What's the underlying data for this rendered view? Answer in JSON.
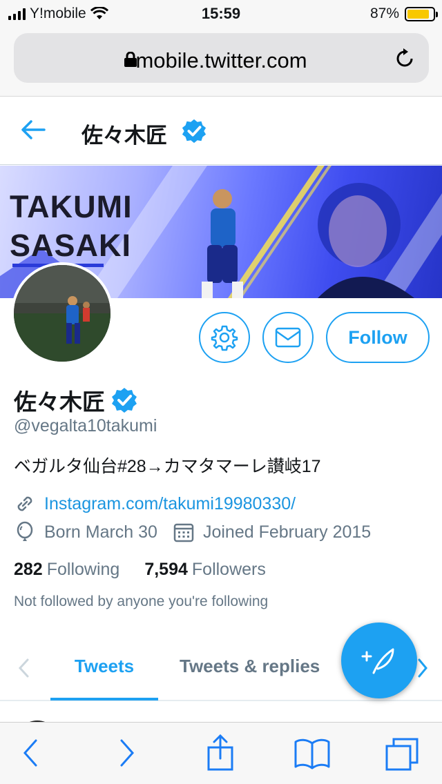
{
  "status_bar": {
    "carrier": "Y!mobile",
    "time": "15:59",
    "battery_percent": "87%",
    "battery_level": 0.87
  },
  "browser": {
    "url": "mobile.twitter.com",
    "icons": [
      "lock-icon",
      "reload-icon"
    ]
  },
  "header": {
    "title": "佐々木匠",
    "verified": true
  },
  "banner": {
    "line1": "TAKUMI",
    "line2": "SASAKI"
  },
  "profile": {
    "name": "佐々木匠",
    "handle": "@vegalta10takumi",
    "bio": "ベガルタ仙台#28→カマタマーレ讃岐17",
    "link": "Instagram.com/takumi19980330/",
    "born": "Born March 30",
    "joined": "Joined February 2015",
    "following_count": "282",
    "following_label": "Following",
    "followers_count": "7,594",
    "followers_label": "Followers",
    "not_followed": "Not followed by anyone you're following"
  },
  "actions": {
    "follow_label": "Follow"
  },
  "tabs": [
    {
      "label": "Tweets",
      "active": true
    },
    {
      "label": "Tweets & replies",
      "active": false
    }
  ],
  "colors": {
    "accent": "#1da1f2",
    "secondary_text": "#657786",
    "link": "#1b95e0"
  }
}
